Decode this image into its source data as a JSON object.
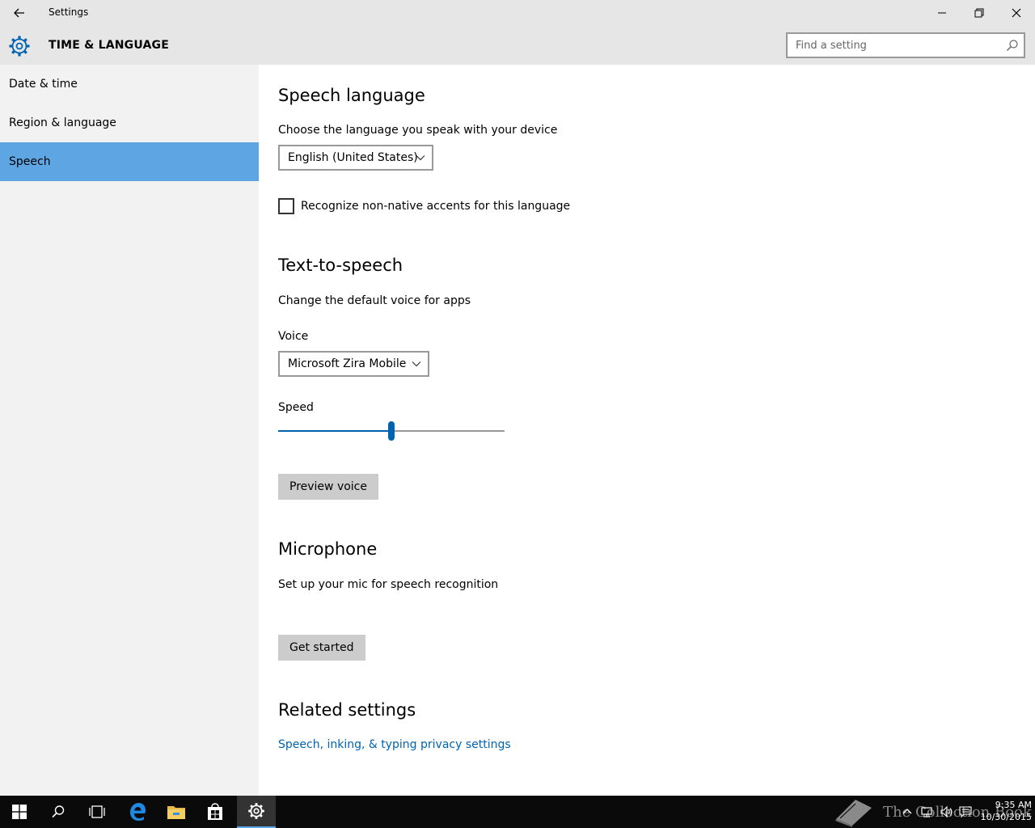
{
  "window": {
    "title": "Settings"
  },
  "header": {
    "section_title": "TIME & LANGUAGE",
    "search_placeholder": "Find a setting"
  },
  "sidebar": {
    "items": [
      {
        "label": "Date & time",
        "active": false
      },
      {
        "label": "Region & language",
        "active": false
      },
      {
        "label": "Speech",
        "active": true
      }
    ]
  },
  "speech_language": {
    "heading": "Speech language",
    "description": "Choose the language you speak with your device",
    "selected_language": "English (United States)",
    "accents_checkbox_label": "Recognize non-native accents for this language",
    "accents_checked": false
  },
  "text_to_speech": {
    "heading": "Text-to-speech",
    "description": "Change the default voice for apps",
    "voice_label": "Voice",
    "selected_voice": "Microsoft Zira Mobile",
    "speed_label": "Speed",
    "speed_fraction": 0.5,
    "preview_button": "Preview voice"
  },
  "microphone": {
    "heading": "Microphone",
    "description": "Set up your mic for speech recognition",
    "get_started_button": "Get started"
  },
  "related": {
    "heading": "Related settings",
    "privacy_link": "Speech, inking, & typing privacy settings"
  },
  "taskbar": {
    "watermark": "The Collection Book",
    "time": "9:35 AM",
    "date": "10/30/2015"
  },
  "colors": {
    "accent": "#0063b1",
    "selection": "#5ea6e3",
    "chrome": "#e6e6e6",
    "sidebar": "#f2f2f2"
  }
}
